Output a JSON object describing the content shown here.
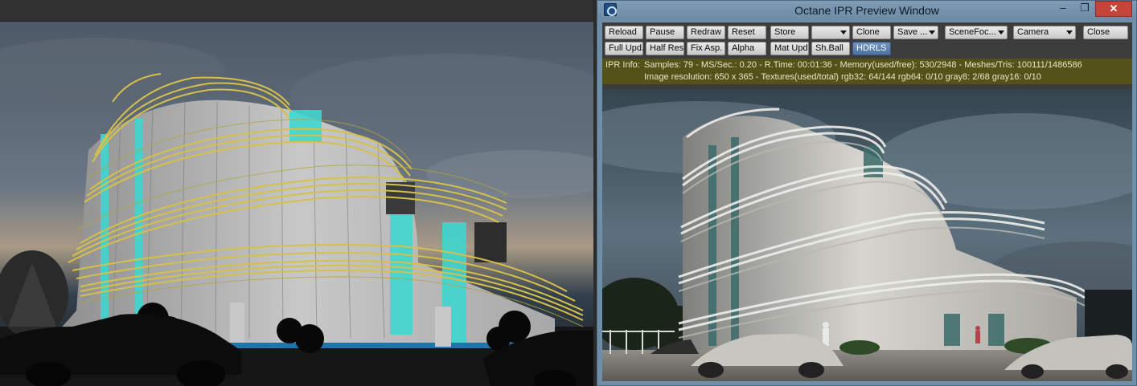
{
  "viewport": {
    "scene": "wireframe-building-view"
  },
  "window": {
    "title": "Octane IPR Preview Window",
    "min_glyph": "–",
    "max_glyph": "❐",
    "close_glyph": "✕"
  },
  "toolbar": {
    "row1": {
      "reload": "Reload",
      "pause": "Pause",
      "redraw": "Redraw",
      "reset": "Reset",
      "store": "Store",
      "store_slot": "",
      "clone": "Clone",
      "save": "Save ...",
      "scene_focus": "SceneFoc...",
      "camera": "Camera",
      "close": "Close"
    },
    "row2": {
      "full_upd": "Full Upd.",
      "half_res": "Half Res",
      "fix_asp": "Fix Asp.",
      "alpha": "Alpha",
      "mat_upd": "Mat Upd",
      "sh_ball": "Sh.Ball",
      "hdrls": "HDRLS"
    }
  },
  "ipr_info": {
    "label": "IPR Info:",
    "line1": "Samples: 79  -  MS/Sec.: 0.20  -  R.Time: 00:01:36 - Memory(used/free): 530/2948  -  Meshes/Tris: 100111/1486586",
    "line2": "Image resolution: 650 x 365 - Textures(used/total) rgb32: 64/144   rgb64: 0/10   gray8: 2/68   gray16: 0/10"
  },
  "colors": {
    "titlebar": "#7594ae",
    "ipr_info_bg": "#545119",
    "active_button": "#5b7fb0",
    "wireframe_gold": "#d6c04a",
    "glass_cyan": "#3fd6cf"
  }
}
